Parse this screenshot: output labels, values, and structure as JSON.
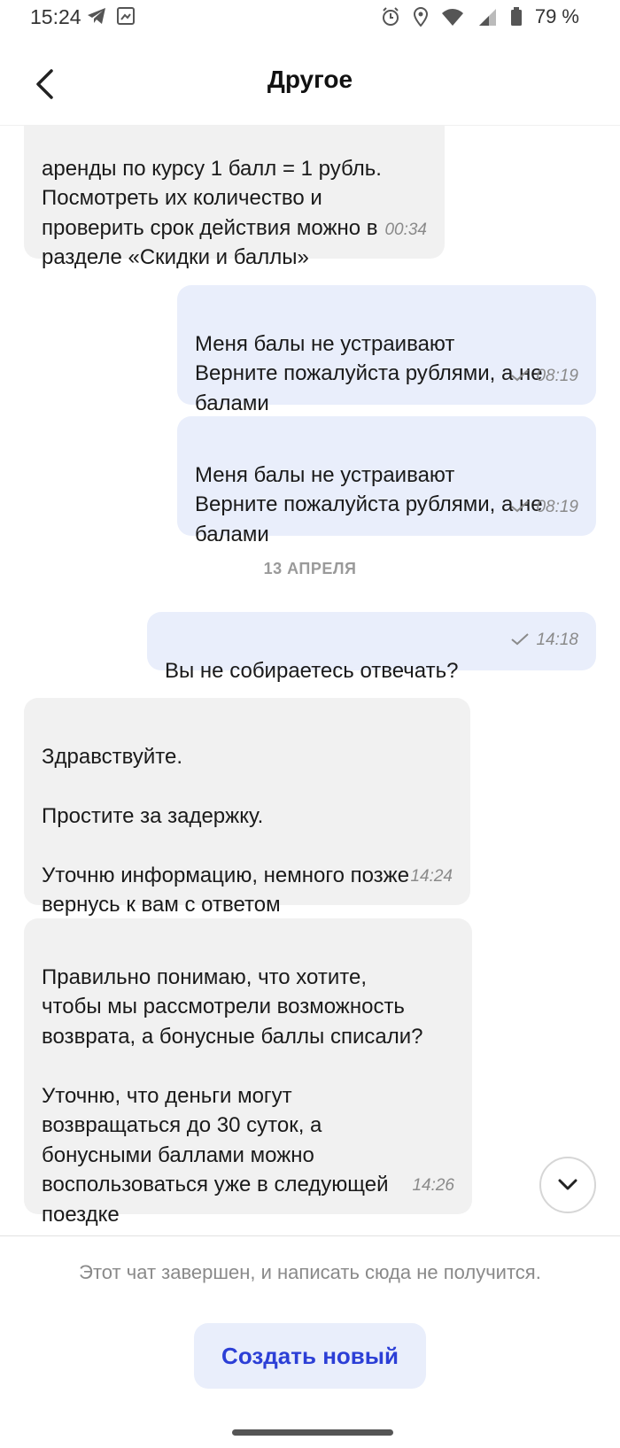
{
  "status_bar": {
    "time": "15:24",
    "battery_pct": "79 %",
    "icons_left": [
      "telegram-icon",
      "photo-icon"
    ],
    "icons_right": [
      "alarm-icon",
      "location-icon",
      "wifi-icon",
      "signal-icon",
      "battery-icon"
    ]
  },
  "header": {
    "title": "Другое",
    "back_icon": "chevron-left-icon"
  },
  "messages": [
    {
      "direction": "incoming",
      "text": "аренды по курсу 1 балл = 1 рубль.\nПосмотреть их количество и\nпроверить срок действия можно в\nразделе «Скидки и баллы»",
      "time": "00:34"
    },
    {
      "direction": "outgoing",
      "text": "Меня балы не устраивают\nВерните пожалуйста рублями, а не\nбалами",
      "time": "08:19",
      "status": "sent"
    },
    {
      "direction": "outgoing",
      "text": "Меня балы не устраивают\nВерните пожалуйста рублями, а не\nбалами",
      "time": "08:19",
      "status": "sent"
    },
    {
      "direction": "outgoing",
      "text": "Вы не собираетесь отвечать?",
      "time": "14:18",
      "status": "sent"
    },
    {
      "direction": "incoming",
      "text": "Здравствуйте.\n\nПростите за задержку.\n\nУточню информацию, немного позже\nвернусь к вам с ответом",
      "time": "14:24"
    },
    {
      "direction": "incoming",
      "text": "Правильно понимаю, что хотите,\nчтобы мы рассмотрели возможность\nвозврата, а бонусные баллы списали?\n\nУточню, что деньги могут\nвозвращаться до 30 суток, а\nбонусными баллами можно\nвоспользоваться уже в следующей\nпоездке",
      "time": "14:26"
    }
  ],
  "date_separator": "13 АПРЕЛЯ",
  "footer": {
    "closed_notice": "Этот чат завершен, и написать сюда не получится.",
    "create_button": "Создать новый",
    "scroll_down_icon": "chevron-down-icon"
  },
  "colors": {
    "incoming_bubble": "#f1f1f1",
    "outgoing_bubble": "#e9eefb",
    "accent_text": "#2c3fd6"
  }
}
